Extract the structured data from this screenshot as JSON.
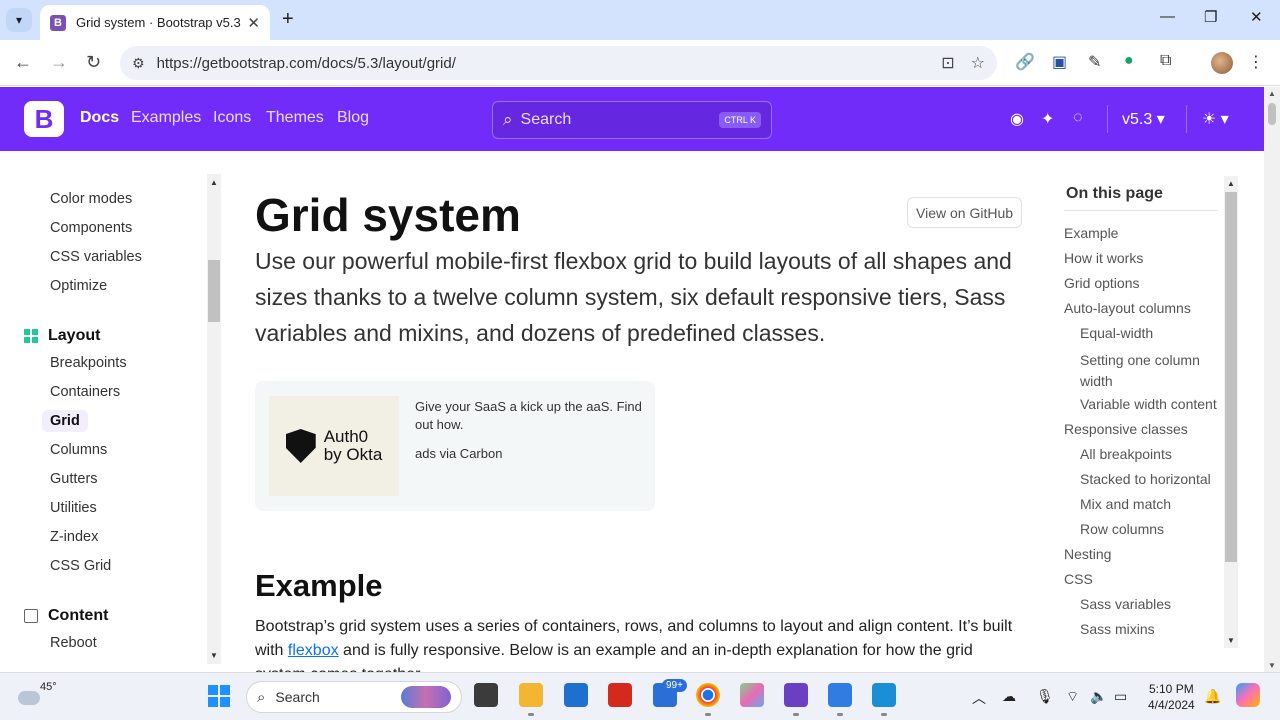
{
  "browser": {
    "tab_title": "Grid system · Bootstrap v5.3",
    "url": "https://getbootstrap.com/docs/5.3/layout/grid/",
    "new_tab_label": "+",
    "window_controls": [
      "—",
      "❐",
      "✕"
    ]
  },
  "navbar": {
    "logo": "B",
    "links": [
      "Docs",
      "Examples",
      "Icons",
      "Themes",
      "Blog"
    ],
    "search_placeholder": "Search",
    "search_shortcut": "CTRL K",
    "version": "v5.3 ▾",
    "theme_toggle": "☀ ▾",
    "accent_color": "#712cf9"
  },
  "sidebar": {
    "top_items": [
      "Color modes",
      "Components",
      "CSS variables",
      "Optimize"
    ],
    "layout_section": "Layout",
    "layout_items": [
      "Breakpoints",
      "Containers",
      "Grid",
      "Columns",
      "Gutters",
      "Utilities",
      "Z-index",
      "CSS Grid"
    ],
    "active_item": "Grid",
    "content_section": "Content",
    "content_items": [
      "Reboot"
    ]
  },
  "main": {
    "title": "Grid system",
    "github_button": "View on GitHub",
    "lead": "Use our powerful mobile-first flexbox grid to build layouts of all shapes and sizes thanks to a twelve column system, six default responsive tiers, Sass variables and mixins, and dozens of predefined classes.",
    "ad": {
      "brand": "Auth0\nby Okta",
      "text": "Give your SaaS a kick up the aaS. Find out how.",
      "via": "ads via Carbon"
    },
    "example_heading": "Example",
    "example_para_before": "Bootstrap’s grid system uses a series of containers, rows, and columns to layout and align content. It’s built with ",
    "example_link": "flexbox",
    "example_para_after": " and is fully responsive. Below is an example and an in-depth explanation for how the grid system comes together."
  },
  "toc": {
    "title": "On this page",
    "items": [
      {
        "label": "Example",
        "level": 1
      },
      {
        "label": "How it works",
        "level": 1
      },
      {
        "label": "Grid options",
        "level": 1
      },
      {
        "label": "Auto-layout columns",
        "level": 1
      },
      {
        "label": "Equal-width",
        "level": 2
      },
      {
        "label": "Setting one column width",
        "level": 2
      },
      {
        "label": "Variable width content",
        "level": 2
      },
      {
        "label": "Responsive classes",
        "level": 1
      },
      {
        "label": "All breakpoints",
        "level": 2
      },
      {
        "label": "Stacked to horizontal",
        "level": 2
      },
      {
        "label": "Mix and match",
        "level": 2
      },
      {
        "label": "Row columns",
        "level": 2
      },
      {
        "label": "Nesting",
        "level": 1
      },
      {
        "label": "CSS",
        "level": 1
      },
      {
        "label": "Sass variables",
        "level": 2
      },
      {
        "label": "Sass mixins",
        "level": 2
      }
    ]
  },
  "taskbar": {
    "weather": "45°",
    "search_placeholder": "Search",
    "notification_badge": "99+",
    "time": "5:10 PM",
    "date": "4/4/2024"
  }
}
